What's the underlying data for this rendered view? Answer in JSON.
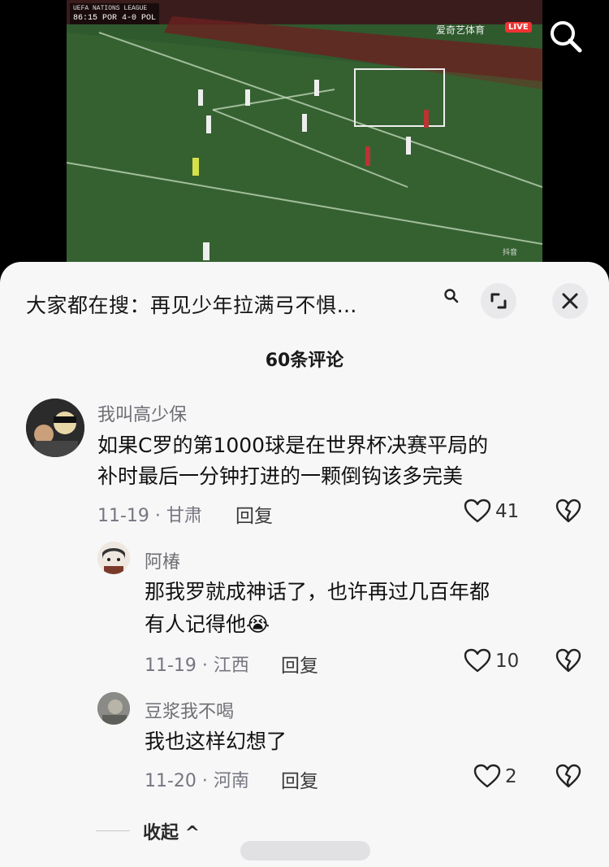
{
  "video": {
    "scoreboard_competition": "UEFA NATIONS LEAGUE",
    "scoreboard_time": "86:15",
    "scoreboard_score": "POR 4-0 POL",
    "channel": "爱奇艺体育",
    "live_badge": "LIVE",
    "tiktok_mark": "抖音",
    "search_icon": "search-icon"
  },
  "sheet": {
    "suggestion": "大家都在搜：再见少年拉满弓不惧…",
    "comment_count": "60条评论",
    "icons": {
      "suggest_search": "search-icon",
      "expand": "expand-icon",
      "close": "close-icon"
    }
  },
  "comments": [
    {
      "user": "我叫高少保",
      "text_line1": "如果C罗的第1000球是在世界杯决赛平局的",
      "text_line2": "补时最后一分钟打进的一颗倒钩该多完美",
      "meta": "11-19 · 甘肃",
      "reply": "回复",
      "likes": "41"
    },
    {
      "user": "阿椿",
      "text_line1": "那我罗就成神话了，也许再过几百年都",
      "text_line2": "有人记得他😭",
      "meta": "11-19 · 江西",
      "reply": "回复",
      "likes": "10"
    },
    {
      "user": "豆浆我不喝",
      "text_line1": "我也这样幻想了",
      "meta": "11-20 · 河南",
      "reply": "回复",
      "likes": "2"
    }
  ],
  "collapse_label": "收起 ^"
}
